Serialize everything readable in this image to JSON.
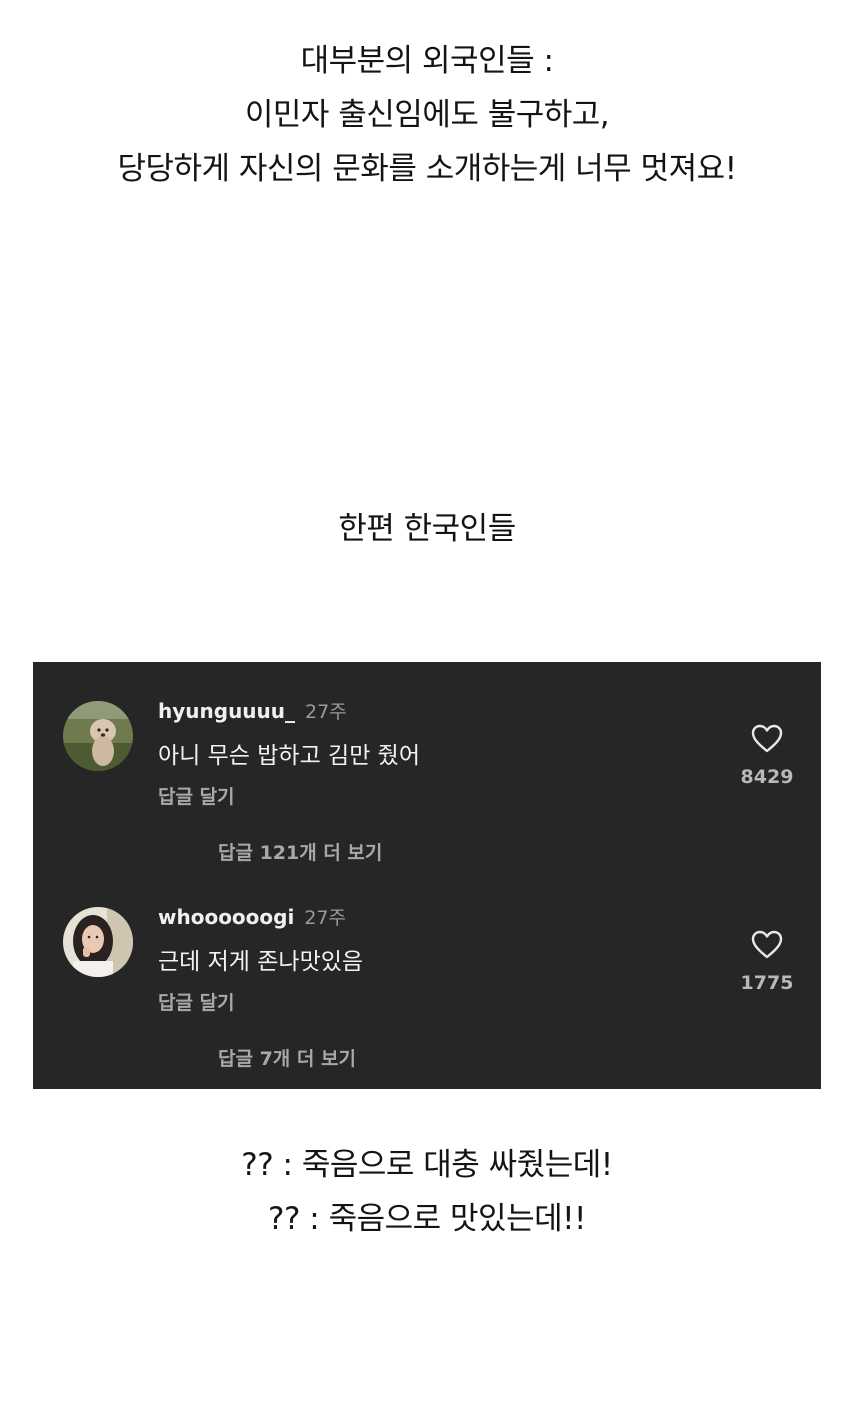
{
  "intro": {
    "lines": [
      "대부분의 외국인들 :",
      "이민자 출신임에도 불구하고,",
      "당당하게 자신의 문화를 소개하는게 너무 멋져요!"
    ]
  },
  "middle": {
    "text": "한편 한국인들"
  },
  "comments": [
    {
      "username": "hyunguuuu_",
      "time": "27주",
      "text": "아니 무슨 밥하고 김만 줬어",
      "reply_label": "답글 달기",
      "like_icon": "heart-outline-icon",
      "likes": "8429",
      "view_replies": "답글 121개 더 보기"
    },
    {
      "username": "whoooooogi",
      "time": "27주",
      "text": "근데 저게 존나맛있음",
      "reply_label": "답글 달기",
      "like_icon": "heart-outline-icon",
      "likes": "1775",
      "view_replies": "답글 7개 더 보기"
    }
  ],
  "outro": {
    "lines": [
      "?? : 죽음으로 대충 싸줬는데!",
      "?? : 죽음으로 맛있는데!!"
    ]
  },
  "colors": {
    "panel_background": "#262626",
    "primary_text_dark": "#141414",
    "primary_text_light": "#f2f2f2",
    "secondary_text": "#a8a8a8"
  }
}
